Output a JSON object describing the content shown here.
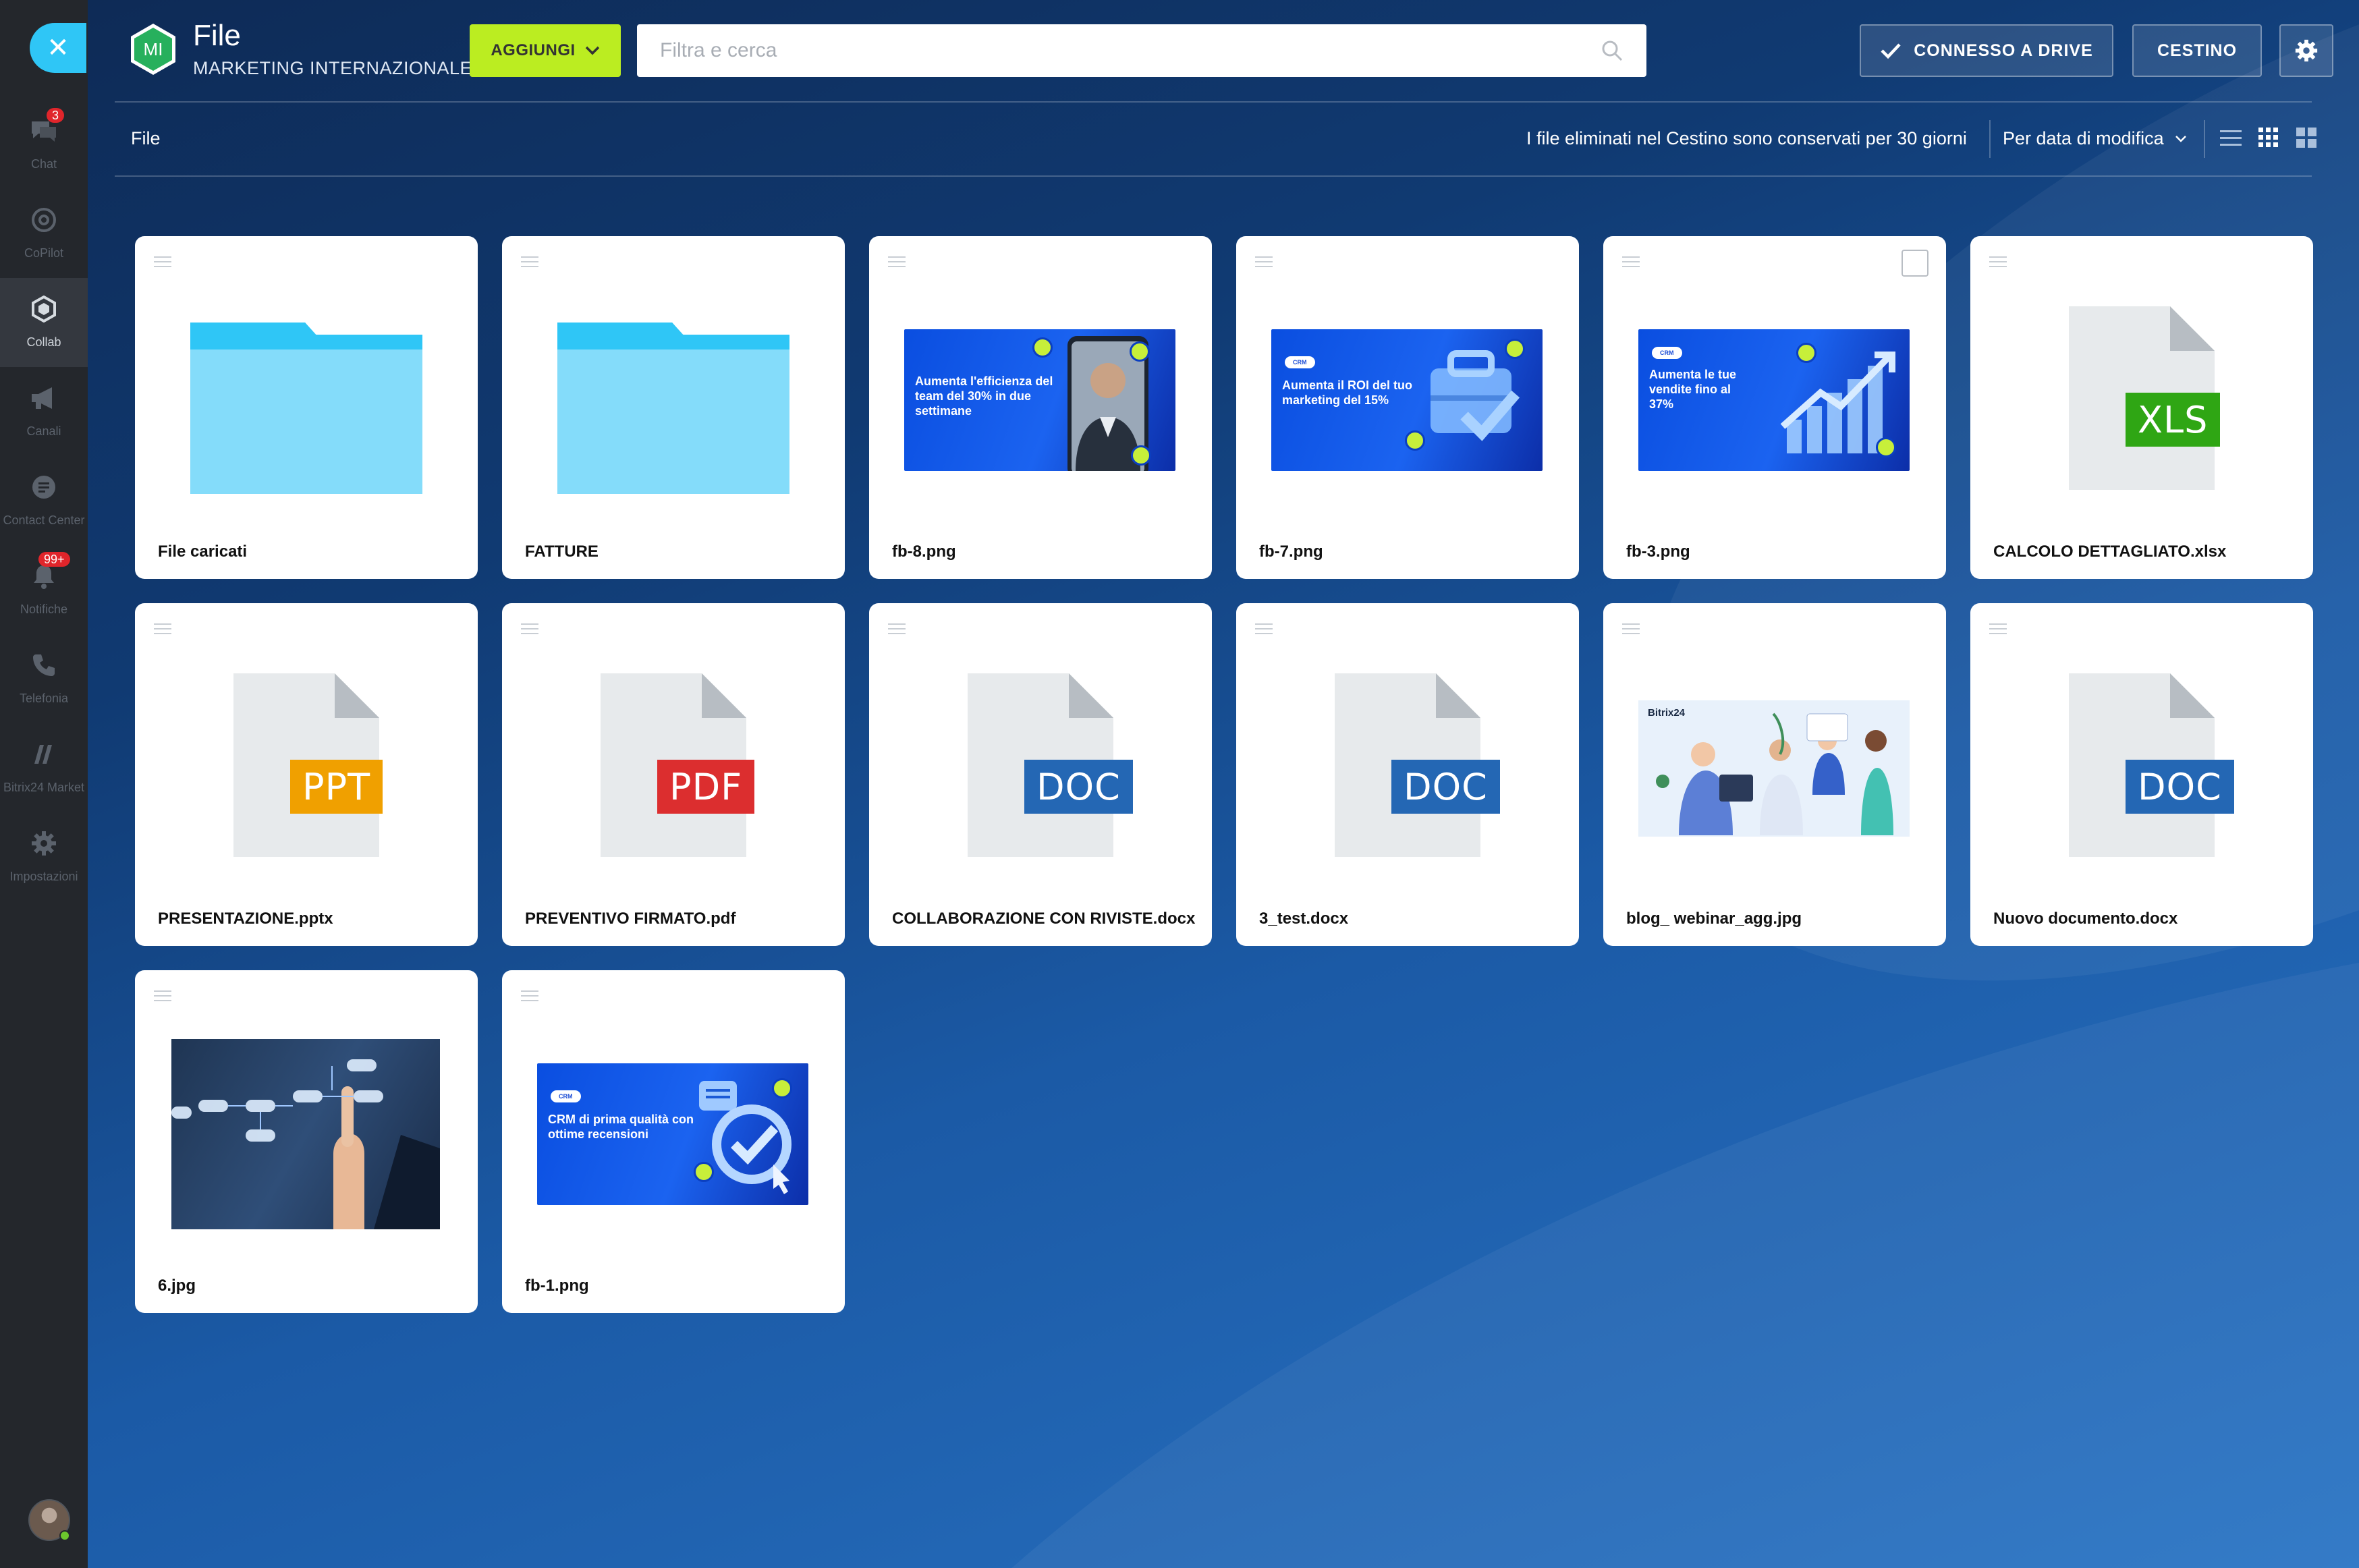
{
  "sidebar": {
    "close_icon": "close-icon",
    "items": [
      {
        "label": "Chat",
        "icon": "chat-icon",
        "badge": "3"
      },
      {
        "label": "CoPilot",
        "icon": "copilot-icon",
        "badge": ""
      },
      {
        "label": "Collab",
        "icon": "collab-icon",
        "badge": "",
        "active": true
      },
      {
        "label": "Canali",
        "icon": "megaphone-icon",
        "badge": ""
      },
      {
        "label": "Contact Center",
        "icon": "contact-center-icon",
        "badge": ""
      },
      {
        "label": "Notifiche",
        "icon": "bell-icon",
        "badge": "99+"
      },
      {
        "label": "Telefonia",
        "icon": "phone-icon",
        "badge": ""
      },
      {
        "label": "Bitrix24 Market",
        "icon": "market-icon",
        "badge": ""
      },
      {
        "label": "Impostazioni",
        "icon": "gear-icon",
        "badge": ""
      }
    ]
  },
  "header": {
    "group_initials": "MI",
    "title": "File",
    "subtitle": "MARKETING INTERNAZIONALE",
    "add_label": "AGGIUNGI",
    "search_placeholder": "Filtra e cerca",
    "drive_label": "CONNESSO A DRIVE",
    "trash_label": "CESTINO"
  },
  "toolbar": {
    "breadcrumb": "File",
    "retention_note": "I file eliminati nel Cestino sono conservati per 30 giorni",
    "sort_label": "Per data di modifica"
  },
  "files": [
    {
      "name": "File caricati",
      "kind": "folder"
    },
    {
      "name": "FATTURE",
      "kind": "folder"
    },
    {
      "name": "fb-8.png",
      "kind": "image",
      "promo": "Aumenta l'efficienza del team del 30% in due settimane"
    },
    {
      "name": "fb-7.png",
      "kind": "image",
      "promo": "Aumenta il ROI del tuo marketing del 15%",
      "pill": "CRM"
    },
    {
      "name": "fb-3.png",
      "kind": "image",
      "promo": "Aumenta le tue vendite fino al 37%",
      "pill": "CRM"
    },
    {
      "name": "CALCOLO DETTAGLIATO.xlsx",
      "kind": "doc",
      "tag": "XLS",
      "color": "#2fa614"
    },
    {
      "name": "PRESENTAZIONE.pptx",
      "kind": "doc",
      "tag": "PPT",
      "color": "#f0a000"
    },
    {
      "name": "PREVENTIVO FIRMATO.pdf",
      "kind": "doc",
      "tag": "PDF",
      "color": "#dc2e2f"
    },
    {
      "name": "COLLABORAZIONE CON RIVISTE.docx",
      "kind": "doc",
      "tag": "DOC",
      "color": "#2467b4"
    },
    {
      "name": "3_test.docx",
      "kind": "doc",
      "tag": "DOC",
      "color": "#2467b4"
    },
    {
      "name": "blog_ webinar_agg.jpg",
      "kind": "image",
      "brand": "Bitrix24"
    },
    {
      "name": "Nuovo documento.docx",
      "kind": "doc",
      "tag": "DOC",
      "color": "#2467b4"
    },
    {
      "name": "6.jpg",
      "kind": "image"
    },
    {
      "name": "fb-1.png",
      "kind": "image",
      "promo": "CRM di prima qualità con ottime recensioni",
      "pill": "CRM"
    }
  ],
  "colors": {
    "accent_lime": "#bbed21",
    "accent_cyan": "#2fc6f6",
    "folder": "#84dcfa"
  }
}
